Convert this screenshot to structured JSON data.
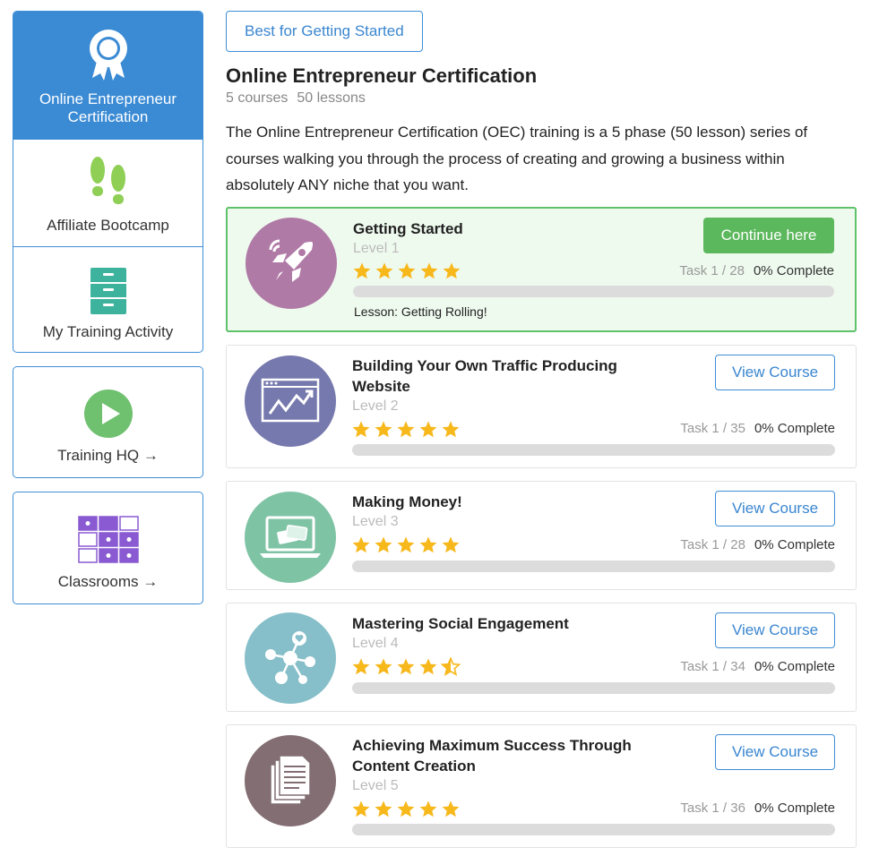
{
  "sidebar": {
    "items": [
      {
        "label": "Online Entrepreneur Certification",
        "icon": "ribbon-badge-icon",
        "active": true
      },
      {
        "label": "Affiliate Bootcamp",
        "icon": "footprints-icon"
      },
      {
        "label": "My Training Activity",
        "icon": "filing-cabinet-icon"
      },
      {
        "label": "Training HQ →",
        "icon": "play-circle-icon"
      },
      {
        "label": "Classrooms →",
        "icon": "classroom-grid-icon"
      }
    ]
  },
  "header": {
    "badge_label": "Best for Getting Started",
    "title": "Online Entrepreneur Certification",
    "courses_count": "5 courses",
    "lessons_count": "50 lessons",
    "description": "The Online Entrepreneur Certification (OEC) training is a 5 phase (50 lesson) series of courses walking you through the process of creating and growing a business within absolutely ANY niche that you want."
  },
  "courses": [
    {
      "title": "Getting Started",
      "level": "Level 1",
      "rating": 5,
      "task": "Task 1 / 28",
      "complete": "0% Complete",
      "progress": 0,
      "button": "Continue here",
      "lesson": "Lesson: Getting Rolling!",
      "icon": "rocket-icon",
      "icon_color": "#b07aa6"
    },
    {
      "title": "Building Your Own Traffic Producing Website",
      "level": "Level 2",
      "rating": 5,
      "task": "Task 1 / 35",
      "complete": "0% Complete",
      "progress": 0,
      "button": "View Course",
      "icon": "website-chart-icon",
      "icon_color": "#7679ad"
    },
    {
      "title": "Making Money!",
      "level": "Level 3",
      "rating": 5,
      "task": "Task 1 / 28",
      "complete": "0% Complete",
      "progress": 0,
      "button": "View Course",
      "icon": "laptop-credit-card-icon",
      "icon_color": "#7fc3a5"
    },
    {
      "title": "Mastering Social Engagement",
      "level": "Level 4",
      "rating": 4.5,
      "task": "Task 1 / 34",
      "complete": "0% Complete",
      "progress": 0,
      "button": "View Course",
      "icon": "social-network-icon",
      "icon_color": "#86bfc9"
    },
    {
      "title": "Achieving Maximum Success Through Content Creation",
      "level": "Level 5",
      "rating": 5,
      "task": "Task 1 / 36",
      "complete": "0% Complete",
      "progress": 0,
      "button": "View Course",
      "icon": "documents-icon",
      "icon_color": "#826e73"
    }
  ],
  "colors": {
    "accent": "#3a8ad4",
    "success": "#5cb85c",
    "star": "#f7b81c"
  }
}
